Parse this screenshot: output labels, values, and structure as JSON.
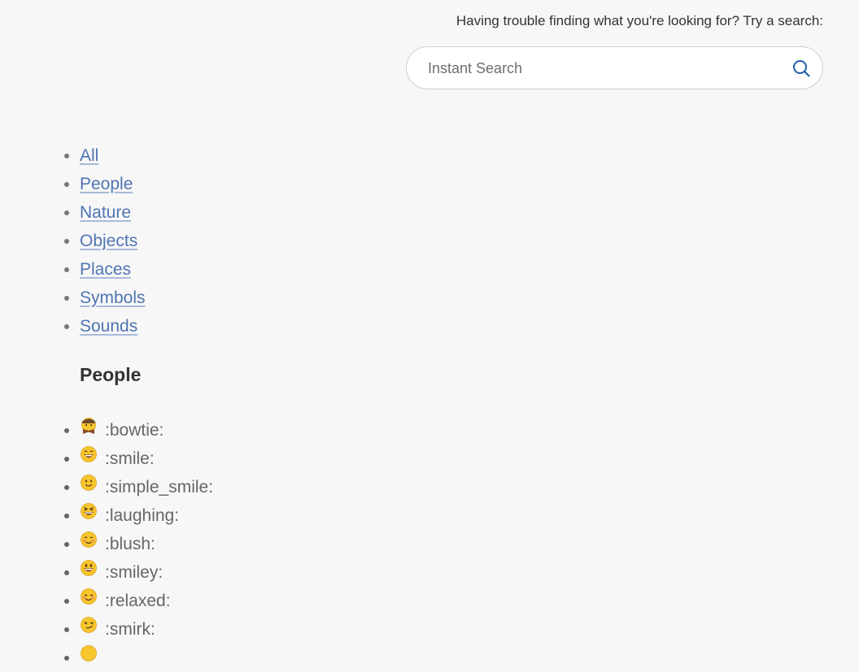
{
  "header": {
    "search_prompt": "Having trouble finding what you're looking for? Try a search:",
    "search_placeholder": "Instant Search"
  },
  "categories": [
    {
      "label": "All"
    },
    {
      "label": "People"
    },
    {
      "label": "Nature"
    },
    {
      "label": "Objects"
    },
    {
      "label": "Places"
    },
    {
      "label": "Symbols"
    },
    {
      "label": "Sounds"
    }
  ],
  "section": {
    "title": "People"
  },
  "emojis": [
    {
      "code": ":bowtie:",
      "icon": "bowtie-icon"
    },
    {
      "code": ":smile:",
      "icon": "smile-icon"
    },
    {
      "code": ":simple_smile:",
      "icon": "simple-smile-icon"
    },
    {
      "code": ":laughing:",
      "icon": "laughing-icon"
    },
    {
      "code": ":blush:",
      "icon": "blush-icon"
    },
    {
      "code": ":smiley:",
      "icon": "smiley-icon"
    },
    {
      "code": ":relaxed:",
      "icon": "relaxed-icon"
    },
    {
      "code": ":smirk:",
      "icon": "smirk-icon"
    },
    {
      "code": "",
      "icon": "face-icon"
    }
  ],
  "colors": {
    "link": "#4f74b3",
    "search_icon": "#1f5fa8",
    "emoji_face": "#f7c52c"
  }
}
